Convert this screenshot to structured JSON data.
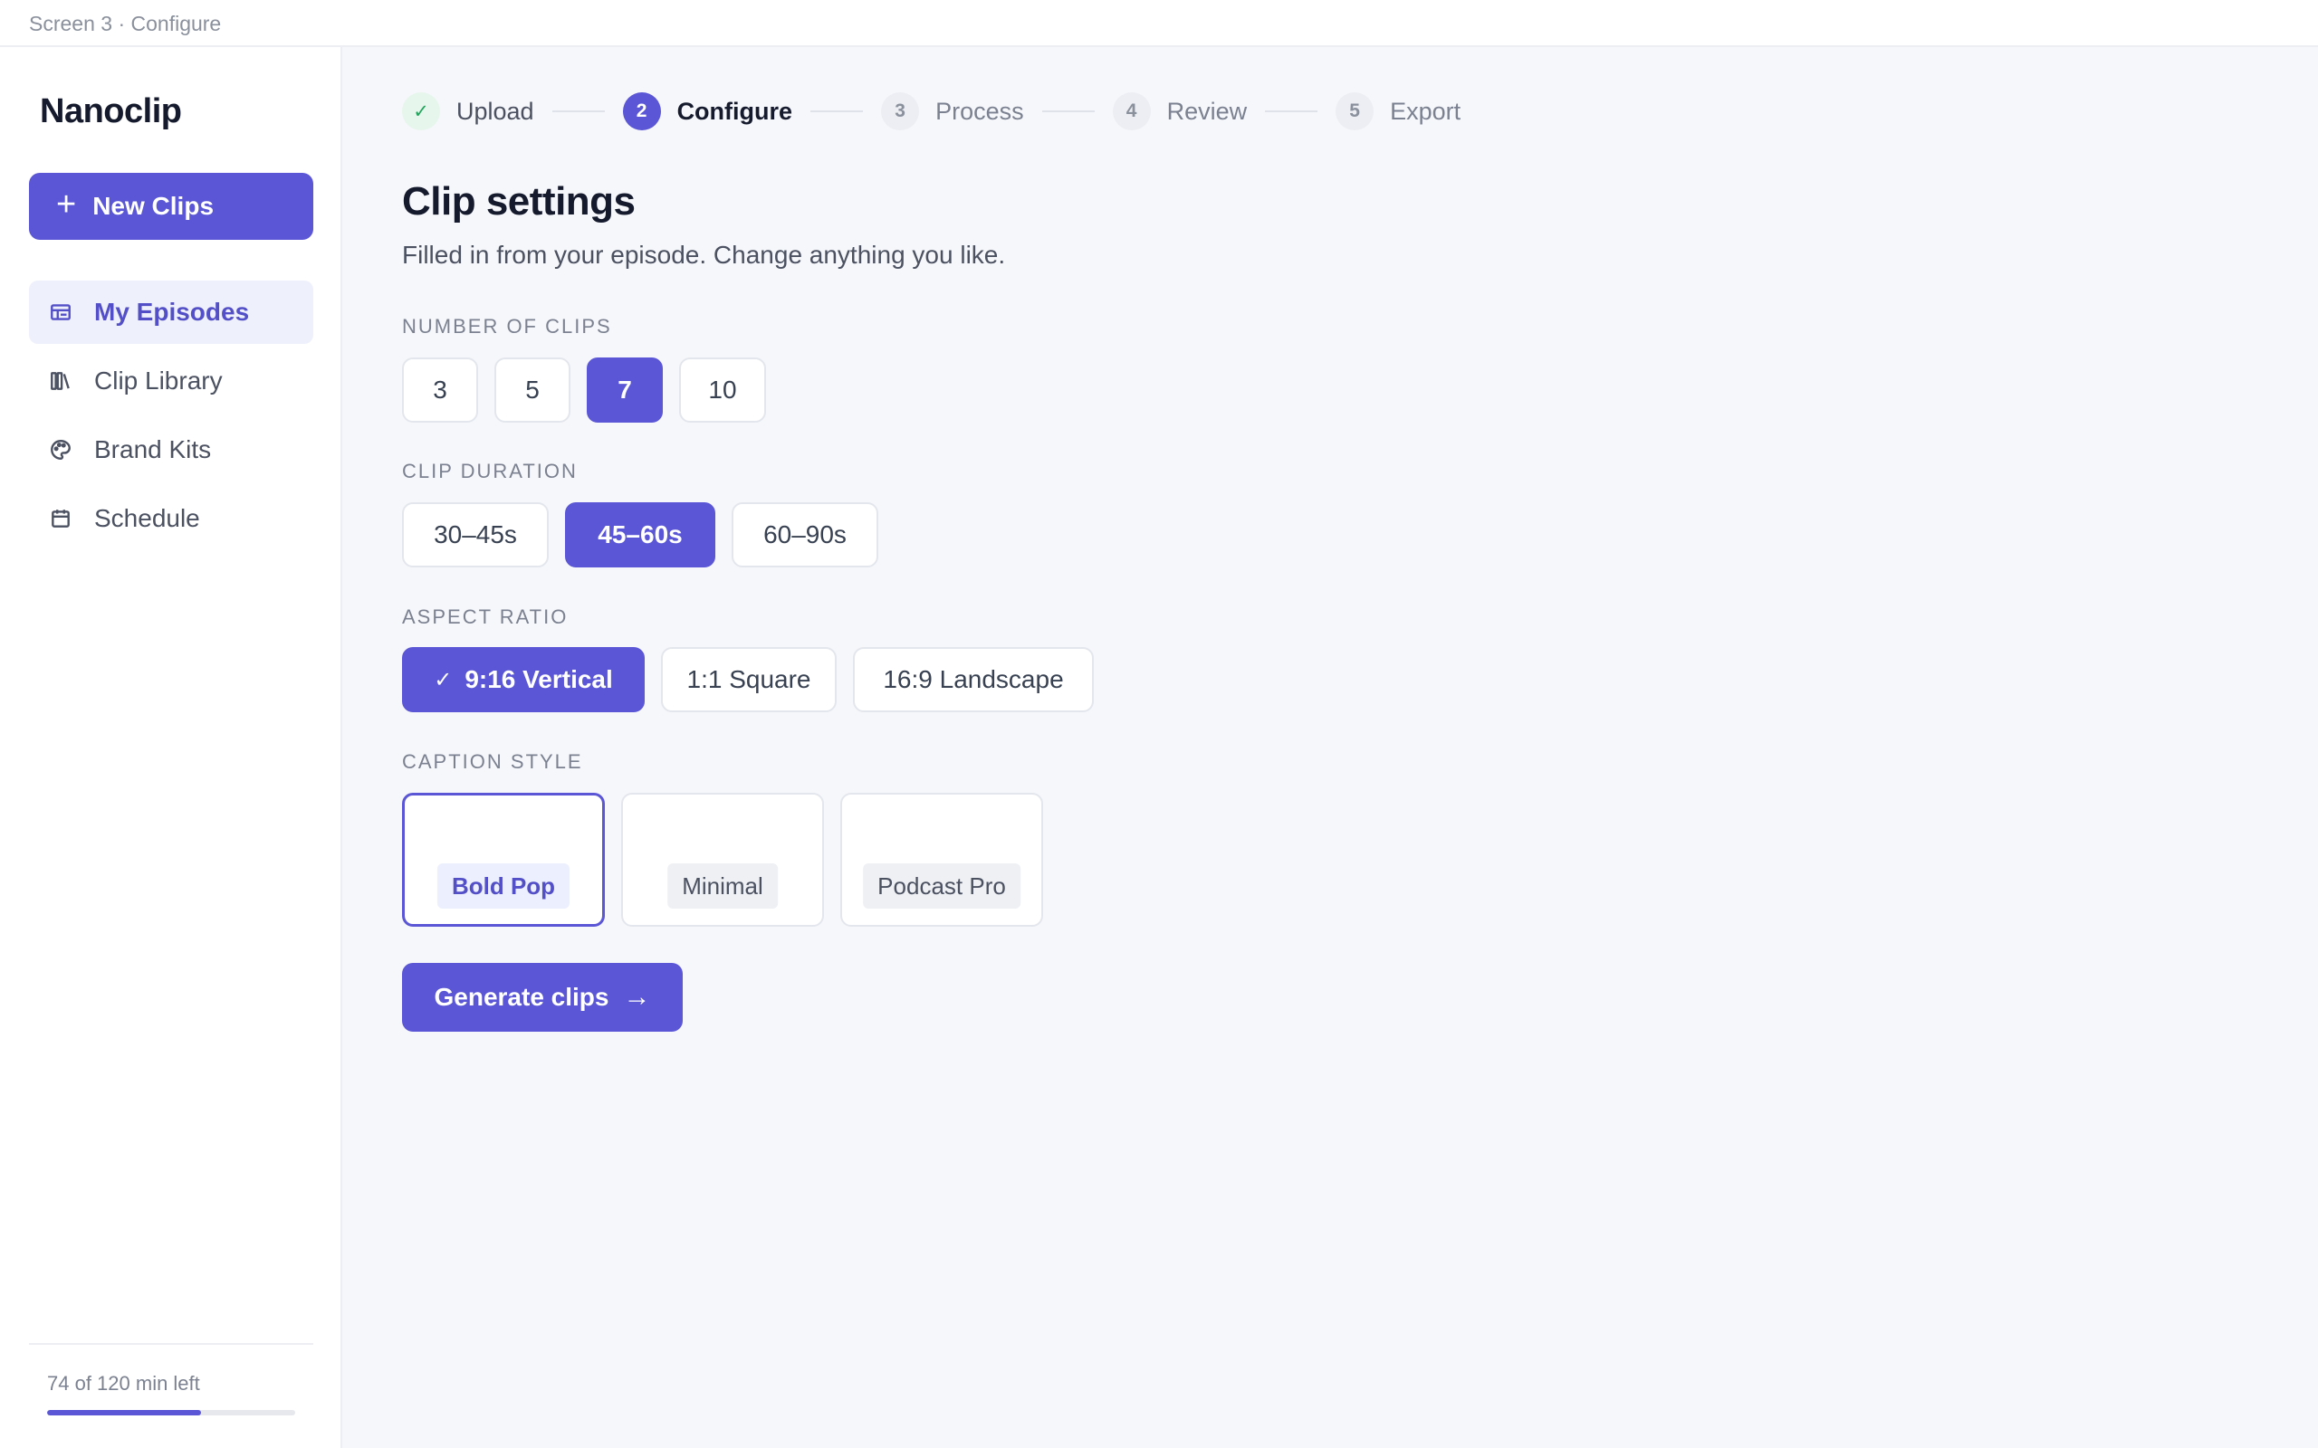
{
  "window": {
    "title": "Screen 3 · Configure"
  },
  "sidebar": {
    "brand": "Nanoclip",
    "new_button": "New Clips",
    "items": [
      {
        "label": "My Episodes",
        "icon": "episodes-icon",
        "active": true
      },
      {
        "label": "Clip Library",
        "icon": "library-icon",
        "active": false
      },
      {
        "label": "Brand Kits",
        "icon": "palette-icon",
        "active": false
      },
      {
        "label": "Schedule",
        "icon": "calendar-icon",
        "active": false
      }
    ],
    "quota": {
      "text": "74 of 120 min left",
      "used_fraction": 0.62
    }
  },
  "stepper": {
    "steps": [
      {
        "number": "✓",
        "label": "Upload",
        "state": "done"
      },
      {
        "number": "2",
        "label": "Configure",
        "state": "current"
      },
      {
        "number": "3",
        "label": "Process",
        "state": "pending"
      },
      {
        "number": "4",
        "label": "Review",
        "state": "pending"
      },
      {
        "number": "5",
        "label": "Export",
        "state": "pending"
      }
    ]
  },
  "main": {
    "title": "Clip settings",
    "subtitle": "Filled in from your episode. Change anything you like.",
    "sections": {
      "number_of_clips": {
        "label": "NUMBER OF CLIPS",
        "options": [
          "3",
          "5",
          "7",
          "10"
        ],
        "selected": "7"
      },
      "clip_duration": {
        "label": "CLIP DURATION",
        "options": [
          "30–45s",
          "45–60s",
          "60–90s"
        ],
        "selected": "45–60s"
      },
      "aspect_ratio": {
        "label": "ASPECT RATIO",
        "options": [
          "9:16 Vertical",
          "1:1 Square",
          "16:9 Landscape"
        ],
        "selected": "9:16 Vertical"
      },
      "caption_style": {
        "label": "CAPTION STYLE",
        "options": [
          "Bold Pop",
          "Minimal",
          "Podcast Pro"
        ],
        "selected": "Bold Pop"
      }
    },
    "generate_button": "Generate clips"
  },
  "colors": {
    "accent": "#5a56d6",
    "accent_soft": "#eef0fb",
    "success": "#22a45d",
    "background": "#f6f7fb"
  }
}
